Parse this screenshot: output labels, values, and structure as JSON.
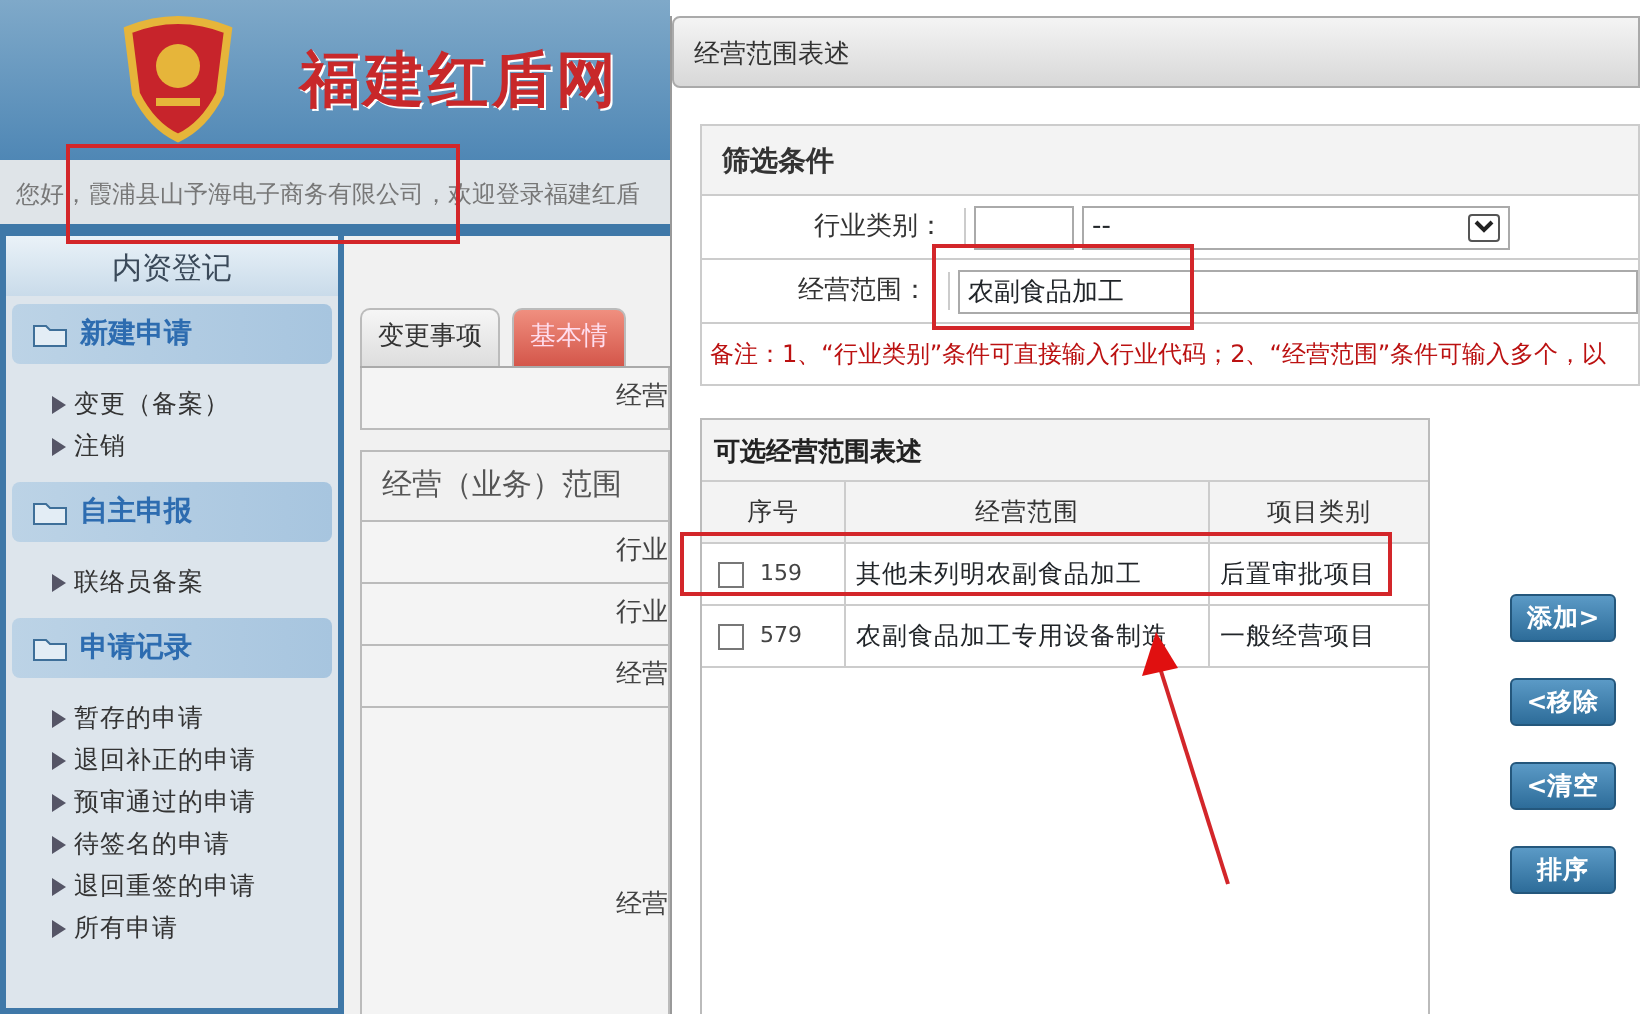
{
  "site": {
    "title": "福建红盾网",
    "welcome": "您好，霞浦县山予海电子商务有限公司，欢迎登录福建红盾"
  },
  "sidebar": {
    "title": "内资登记",
    "sections": [
      {
        "title": "新建申请",
        "items": [
          "变更（备案）",
          "注销"
        ]
      },
      {
        "title": "自主申报",
        "items": [
          "联络员备案"
        ]
      },
      {
        "title": "申请记录",
        "items": [
          "暂存的申请",
          "退回补正的申请",
          "预审通过的申请",
          "待签名的申请",
          "退回重签的申请",
          "所有申请"
        ]
      }
    ]
  },
  "tabs": [
    {
      "label": "变更事项",
      "selected": false
    },
    {
      "label": "基本情",
      "selected": true
    }
  ],
  "form": {
    "top_label": "经营",
    "section_title": "经营（业务）范围",
    "rows": [
      "行业",
      "行业",
      "经营"
    ],
    "tall_row": "经营"
  },
  "dialog": {
    "title": "经营范围表述",
    "filter": {
      "title": "筛选条件",
      "fields": [
        {
          "kind": "code_select",
          "label": "行业类别：",
          "select_value": "--"
        },
        {
          "kind": "text",
          "label": "经营范围：",
          "value": "农副食品加工"
        }
      ],
      "note": "备注：1、“行业类别”条件可直接输入行业代码；2、“经营范围”条件可输入多个，以"
    },
    "table": {
      "title": "可选经营范围表述",
      "columns": [
        "序号",
        "经营范围",
        "项目类别"
      ],
      "rows": [
        {
          "checked": false,
          "cells": [
            "159",
            "其他未列明农副食品加工",
            "后置审批项目"
          ]
        },
        {
          "checked": false,
          "cells": [
            "579",
            "农副食品加工专用设备制造",
            "一般经营项目"
          ]
        }
      ]
    },
    "buttons": [
      "添加>",
      "<移除",
      "<清空",
      "排序"
    ]
  }
}
